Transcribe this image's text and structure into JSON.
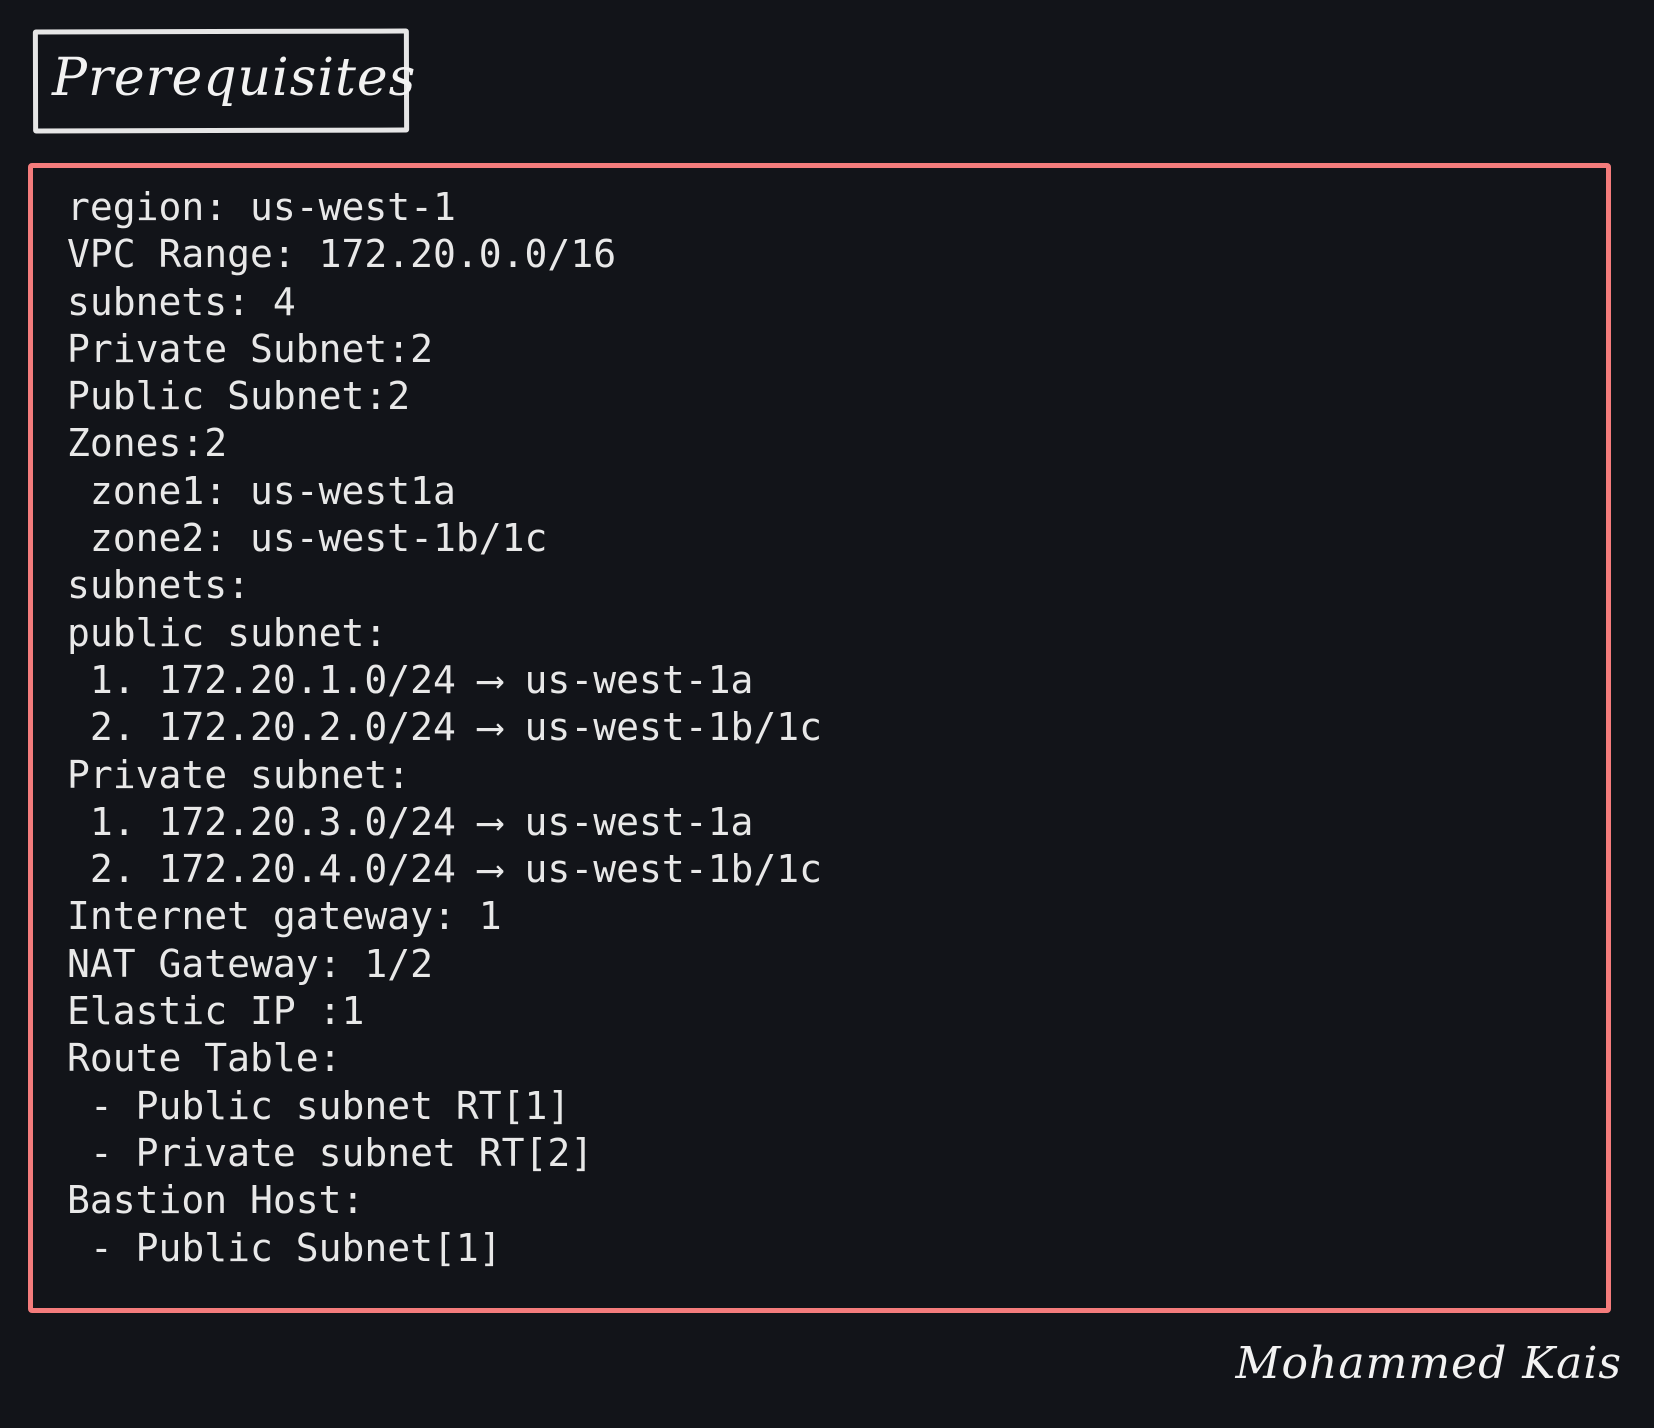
{
  "title": "Prerequisites",
  "lines": [
    "region: us-west-1",
    "VPC Range: 172.20.0.0/16",
    "subnets: 4",
    "Private Subnet:2",
    "Public Subnet:2",
    "Zones:2",
    " zone1: us-west1a",
    " zone2: us-west-1b/1c",
    "subnets:",
    "public subnet:",
    " 1. 172.20.1.0/24 ⟶ us-west-1a",
    " 2. 172.20.2.0/24 ⟶ us-west-1b/1c",
    "Private subnet:",
    " 1. 172.20.3.0/24 ⟶ us-west-1a",
    " 2. 172.20.4.0/24 ⟶ us-west-1b/1c",
    "Internet gateway: 1",
    "NAT Gateway: 1/2",
    "Elastic IP :1",
    "Route Table:",
    " - Public subnet RT[1]",
    " - Private subnet RT[2]",
    "Bastion Host:",
    " - Public Subnet[1]"
  ],
  "signature": "Mohammed Kais",
  "colors": {
    "background": "#121419",
    "box_border": "#f47c7c",
    "title_border": "#e6e6e6",
    "text": "#e8e8e8"
  }
}
